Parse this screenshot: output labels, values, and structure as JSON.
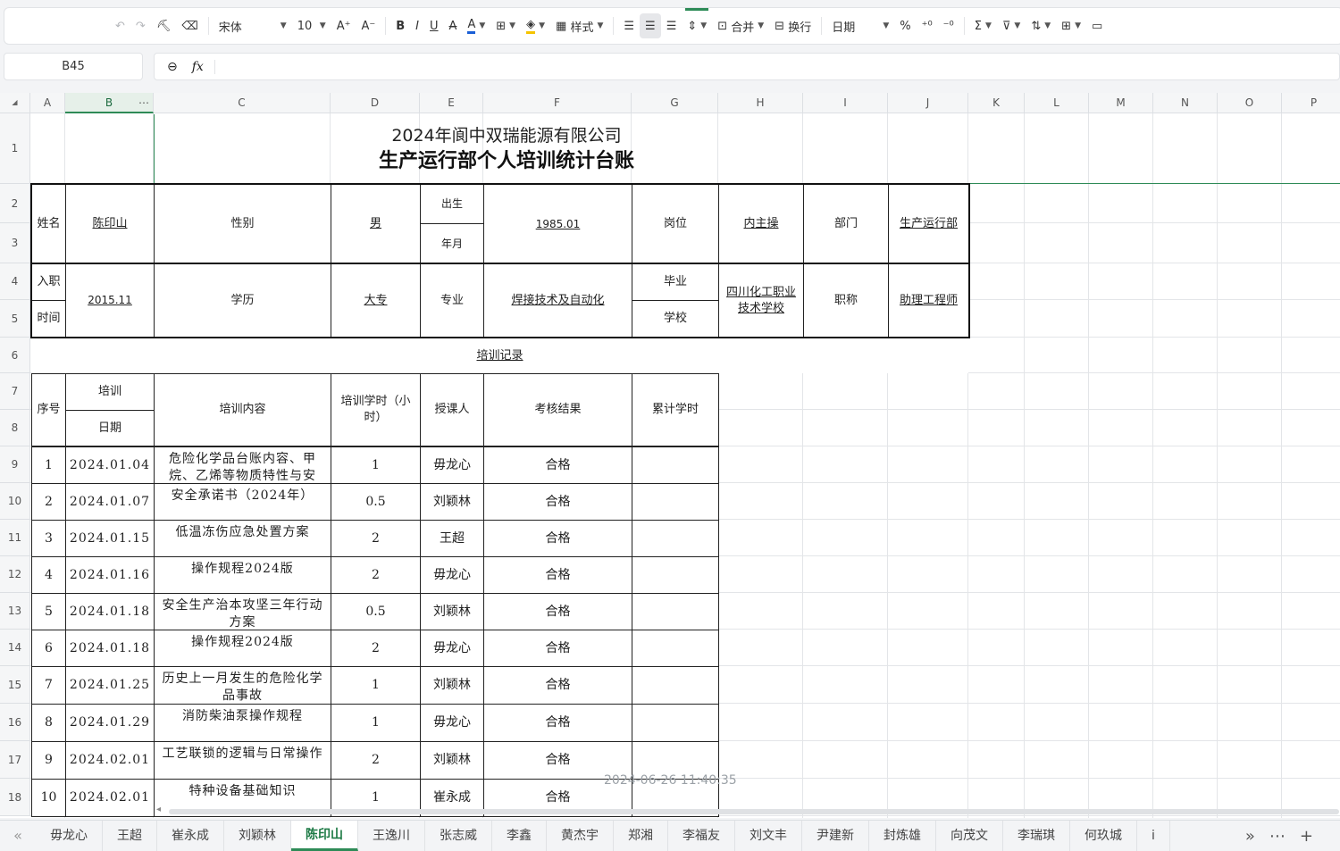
{
  "toolbar": {
    "font": "宋体",
    "size": "10",
    "style_label": "样式",
    "merge_label": "合并",
    "wrap_label": "换行",
    "number_format": "日期",
    "percent": "%"
  },
  "formula_bar": {
    "cell_ref": "B45",
    "fx": "fx",
    "value": ""
  },
  "columns": [
    "A",
    "B",
    "C",
    "D",
    "E",
    "F",
    "G",
    "H",
    "I",
    "J",
    "K",
    "L",
    "M",
    "N",
    "O",
    "P"
  ],
  "rows": [
    "1",
    "2",
    "3",
    "4",
    "5",
    "6",
    "7",
    "8",
    "9",
    "10",
    "11",
    "12",
    "13",
    "14",
    "15",
    "16",
    "17",
    "18"
  ],
  "sheet": {
    "title1": "2024年阆中双瑞能源有限公司",
    "title2": "生产运行部个人培训统计台账",
    "info": {
      "name_label": "姓名",
      "name": "陈印山",
      "gender_label": "性别",
      "gender": "男",
      "birth_label_1": "出生",
      "birth_label_2": "年月",
      "birth": "1985.01",
      "post_label": "岗位",
      "post": "内主操",
      "dept_label": "部门",
      "dept": "生产运行部",
      "hire_label_1": "入职",
      "hire_label_2": "时间",
      "hire": "2015.11",
      "edu_label": "学历",
      "edu": "大专",
      "major_label": "专业",
      "major": "焊接技术及自动化",
      "school_label_1": "毕业",
      "school_label_2": "学校",
      "school": "四川化工职业技术学校",
      "title_label": "职称",
      "title": "助理工程师"
    },
    "records_title": "培训记录",
    "headers": {
      "no": "序号",
      "date_1": "培训",
      "date_2": "日期",
      "content": "培训内容",
      "hours": "培训学时（小时）",
      "teacher": "授课人",
      "result": "考核结果",
      "total": "累计学时"
    },
    "records": [
      {
        "no": "1",
        "date": "2024.01.04",
        "content": "危险化学品台账内容、甲烷、乙烯等物质特性与安",
        "hours": "1",
        "teacher": "毋龙心",
        "result": "合格"
      },
      {
        "no": "2",
        "date": "2024.01.07",
        "content": "安全承诺书（2024年）",
        "hours": "0.5",
        "teacher": "刘颖林",
        "result": "合格"
      },
      {
        "no": "3",
        "date": "2024.01.15",
        "content": "低温冻伤应急处置方案",
        "hours": "2",
        "teacher": "王超",
        "result": "合格"
      },
      {
        "no": "4",
        "date": "2024.01.16",
        "content": "操作规程2024版",
        "hours": "2",
        "teacher": "毋龙心",
        "result": "合格"
      },
      {
        "no": "5",
        "date": "2024.01.18",
        "content": "安全生产治本攻坚三年行动方案",
        "hours": "0.5",
        "teacher": "刘颖林",
        "result": "合格"
      },
      {
        "no": "6",
        "date": "2024.01.18",
        "content": "操作规程2024版",
        "hours": "2",
        "teacher": "毋龙心",
        "result": "合格"
      },
      {
        "no": "7",
        "date": "2024.01.25",
        "content": "历史上一月发生的危险化学品事故",
        "hours": "1",
        "teacher": "刘颖林",
        "result": "合格"
      },
      {
        "no": "8",
        "date": "2024.01.29",
        "content": "消防柴油泵操作规程",
        "hours": "1",
        "teacher": "毋龙心",
        "result": "合格"
      },
      {
        "no": "9",
        "date": "2024.02.01",
        "content": "工艺联锁的逻辑与日常操作",
        "hours": "2",
        "teacher": "刘颖林",
        "result": "合格"
      },
      {
        "no": "10",
        "date": "2024.02.01",
        "content": "特种设备基础知识",
        "hours": "1",
        "teacher": "崔永成",
        "result": "合格"
      }
    ]
  },
  "watermark": "2024-06-26 11:40:35",
  "tabs": [
    "毋龙心",
    "王超",
    "崔永成",
    "刘颖林",
    "陈印山",
    "王逸川",
    "张志威",
    "李鑫",
    "黄杰宇",
    "郑湘",
    "李福友",
    "刘文丰",
    "尹建新",
    "封炼雄",
    "向茂文",
    "李瑞琪",
    "何玖城",
    "i"
  ],
  "active_tab": "陈印山"
}
